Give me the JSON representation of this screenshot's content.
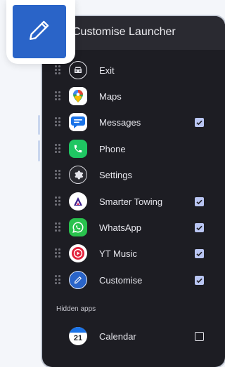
{
  "dialog": {
    "title": "Customise Launcher"
  },
  "launcher_items": [
    {
      "label": "Exit",
      "icon": "car-icon",
      "checked": null
    },
    {
      "label": "Maps",
      "icon": "maps-pin-icon",
      "checked": null
    },
    {
      "label": "Messages",
      "icon": "message-bubble-icon",
      "checked": true
    },
    {
      "label": "Phone",
      "icon": "phone-icon",
      "checked": null
    },
    {
      "label": "Settings",
      "icon": "gear-icon",
      "checked": null
    },
    {
      "label": "Smarter Towing",
      "icon": "triangle-logo-icon",
      "checked": true
    },
    {
      "label": "WhatsApp",
      "icon": "whatsapp-icon",
      "checked": true
    },
    {
      "label": "YT Music",
      "icon": "play-circle-icon",
      "checked": true
    },
    {
      "label": "Customise",
      "icon": "pencil-icon",
      "checked": true
    }
  ],
  "hidden_section": {
    "label": "Hidden apps",
    "items": [
      {
        "label": "Calendar",
        "icon": "calendar-icon",
        "checked": false,
        "icon_text": "21"
      }
    ]
  },
  "colors": {
    "accent": "#2a64c8",
    "panel_bg": "#1d1d23",
    "checkbox_checked": "#b9c5f2"
  }
}
